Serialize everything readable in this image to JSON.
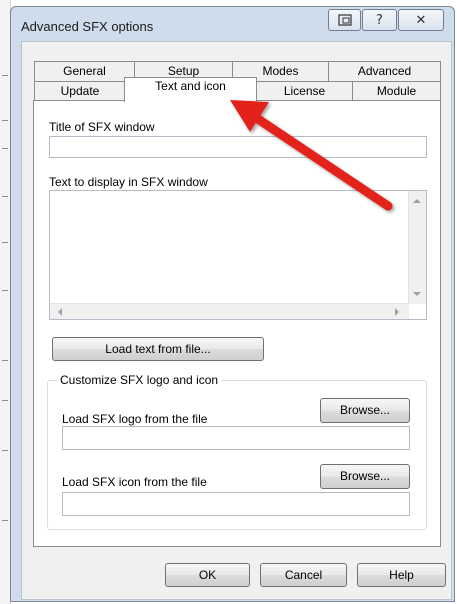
{
  "window": {
    "title": "Advanced SFX options"
  },
  "tabs_back": [
    {
      "label": "General"
    },
    {
      "label": "Setup"
    },
    {
      "label": "Modes"
    },
    {
      "label": "Advanced"
    }
  ],
  "tabs_front": [
    {
      "label": "Update"
    },
    {
      "label": "Text and icon"
    },
    {
      "label": "License"
    },
    {
      "label": "Module"
    }
  ],
  "panel": {
    "title_label": "Title of SFX window",
    "title_value": "",
    "text_label": "Text to display in SFX window",
    "text_value": "",
    "load_text_button": "Load text from file...",
    "group_label": "Customize SFX logo and icon",
    "logo_label": "Load SFX logo from the file",
    "logo_value": "",
    "logo_browse": "Browse...",
    "icon_label": "Load SFX icon from the file",
    "icon_value": "",
    "icon_browse": "Browse..."
  },
  "footer": {
    "ok": "OK",
    "cancel": "Cancel",
    "help": "Help"
  },
  "annotation": {
    "arrow_color": "#e3201b"
  }
}
